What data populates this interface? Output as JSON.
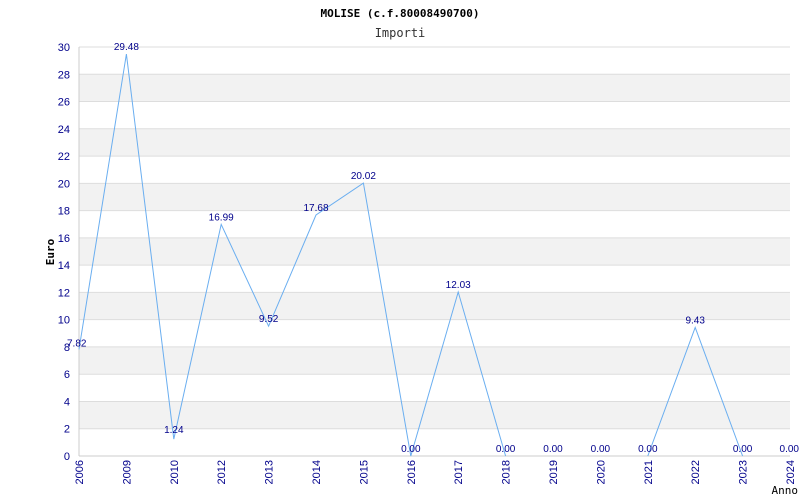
{
  "chart_data": {
    "type": "line",
    "title": "MOLISE (c.f.80008490700)",
    "subtitle": "Importi",
    "xlabel": "Anno",
    "ylabel": "Euro",
    "ylim": [
      0,
      30
    ],
    "y_ticks": [
      "0",
      "2",
      "4",
      "6",
      "8",
      "10",
      "12",
      "14",
      "16",
      "18",
      "20",
      "22",
      "24",
      "26",
      "28",
      "30"
    ],
    "grid": "horizontal bands",
    "series_color": "#6aaef0",
    "categories": [
      "2006",
      "2009",
      "2010",
      "2012",
      "2013",
      "2014",
      "2015",
      "2016",
      "2017",
      "2018",
      "2019",
      "2020",
      "2021",
      "2022",
      "2023",
      "2024"
    ],
    "values": [
      7.82,
      29.48,
      1.24,
      16.99,
      9.52,
      17.68,
      20.02,
      0.0,
      12.03,
      0.0,
      null,
      null,
      0.0,
      9.43,
      0.0,
      null
    ],
    "data_labels": [
      "7.82",
      "29.48",
      "1.24",
      "16.99",
      "9.52",
      "17.68",
      "20.02",
      "0.00",
      "12.03",
      "0.00",
      "0.00",
      "0.00",
      "0.00",
      "9.43",
      "0.00",
      "0.00"
    ]
  }
}
